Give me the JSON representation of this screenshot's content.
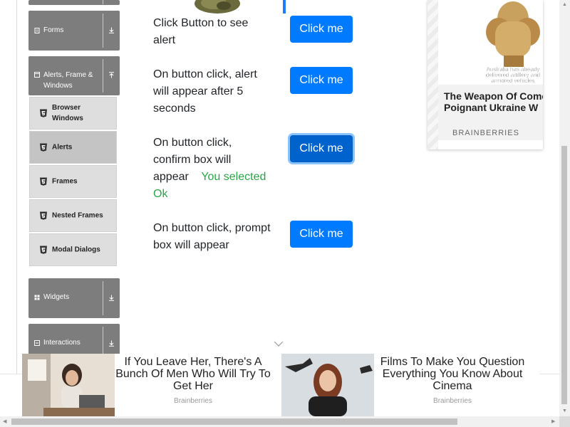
{
  "sidebar": {
    "groups": [
      {
        "label": "Forms",
        "icon": "document-icon",
        "arrow": "expand-arrow-icon"
      },
      {
        "label": "Alerts, Frame & Windows",
        "icon": "window-icon",
        "arrow": "collapse-arrow-icon"
      },
      {
        "label": "Widgets",
        "icon": "grid-icon",
        "arrow": "expand-arrow-icon"
      },
      {
        "label": "Interactions",
        "icon": "list-icon",
        "arrow": "expand-arrow-icon"
      }
    ],
    "items": [
      {
        "label": "Browser Windows",
        "active": false
      },
      {
        "label": "Alerts",
        "active": true
      },
      {
        "label": "Frames",
        "active": false
      },
      {
        "label": "Nested Frames",
        "active": false
      },
      {
        "label": "Modal Dialogs",
        "active": false
      }
    ]
  },
  "main": {
    "rows": [
      {
        "text": "Click Button to see alert",
        "button": "Click me"
      },
      {
        "text": "On button click, alert will appear after 5 seconds",
        "button": "Click me"
      },
      {
        "text": "On button click, confirm box will appear",
        "result": "You selected Ok",
        "button": "Click me"
      },
      {
        "text": "On button click, prompt box will appear",
        "button": "Click me"
      }
    ]
  },
  "side_ad": {
    "image_caption": "Australia has already delivered artillery and armored vehicles",
    "headline": "The Weapon Of Comedy Most Poignant Ukraine W",
    "source": "BRAINBERRIES"
  },
  "bottom_ads": [
    {
      "headline": "If You Leave Her, There's A Bunch Of Men Who Will Try To Get Her",
      "source": "Brainberries"
    },
    {
      "headline": "Films To Make You Question Everything You Know About Cinema",
      "source": "Brainberries"
    }
  ],
  "colors": {
    "sidebar_group": "#7d7d7d",
    "sidebar_item": "#dedede",
    "sidebar_item_active": "#c4c4c4",
    "primary_button": "#007bff",
    "success_text": "#28a745"
  }
}
